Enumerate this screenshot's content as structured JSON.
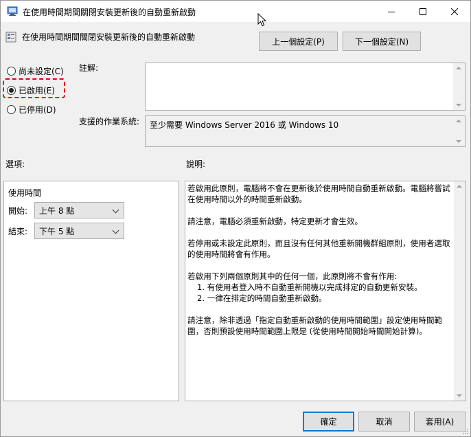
{
  "window": {
    "title": "在使用時間期間關閉安裝更新後的自動重新啟動",
    "controls": {
      "minimize": "minimize-icon",
      "maximize": "maximize-icon",
      "close": "close-icon"
    }
  },
  "header": {
    "policy_title": "在使用時間期間關閉安裝更新後的自動重新啟動",
    "prev_button": "上一個設定(P)",
    "next_button": "下一個設定(N)"
  },
  "state": {
    "options": [
      {
        "label": "尚未設定(C)",
        "checked": false
      },
      {
        "label": "已啟用(E)",
        "checked": true
      },
      {
        "label": "已停用(D)",
        "checked": false
      }
    ],
    "highlight_color": "#e0001b"
  },
  "comment": {
    "label": "註解:",
    "value": ""
  },
  "supported": {
    "label": "支援的作業系統:",
    "value": "至少需要 Windows Server 2016 或 Windows 10"
  },
  "options_section": {
    "label": "選項:",
    "heading": "使用時間",
    "start_label": "開始:",
    "start_value": "上午 8 點",
    "end_label": "結束:",
    "end_value": "下午 5 點"
  },
  "help_section": {
    "label": "說明:",
    "p1": "若啟用此原則，電腦將不會在更新後於使用時間自動重新啟動。電腦將嘗試在使用時間以外的時間重新啟動。",
    "p2": "請注意，電腦必須重新啟動，特定更新才會生效。",
    "p3": "若停用或未設定此原則，而且沒有任何其他重新開機群組原則，使用者選取的使用時間將會有作用。",
    "p4_intro": "若啟用下列兩個原則其中的任何一個，此原則將不會有作用:",
    "p4_items": [
      "1. 有使用者登入時不自動重新開機以完成排定的自動更新安裝。",
      "2. 一律在排定的時間自動重新啟動。"
    ],
    "p5": "請注意，除非透過「指定自動重新啟動的使用時間範圍」設定使用時間範圍，否則預設使用時間範圍上限是 (從使用時間開始時間開始計算)。"
  },
  "footer": {
    "ok_button": "確定",
    "cancel_button": "取消",
    "apply_button": "套用(A)",
    "accent_color": "#0078d7"
  }
}
